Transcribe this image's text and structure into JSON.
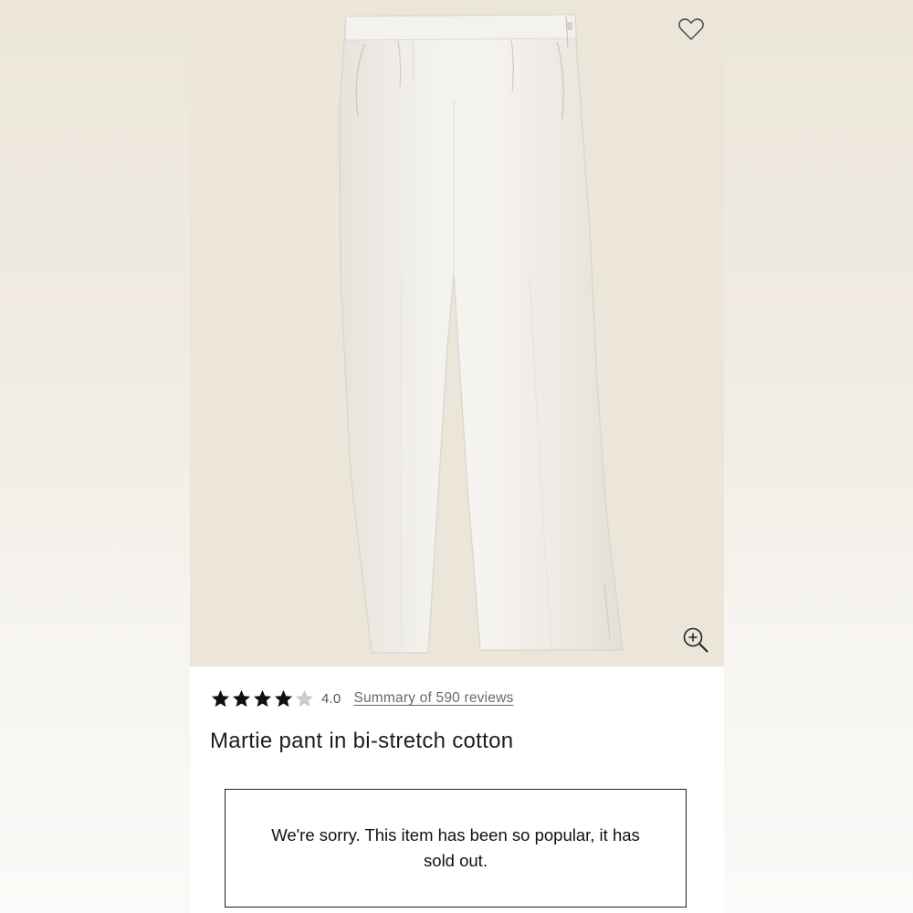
{
  "product": {
    "title": "Martie pant in bi-stretch cotton",
    "rating": {
      "value": 4.0,
      "max": 5,
      "value_label": "4.0",
      "reviews_link": "Summary of 590 reviews"
    },
    "sold_out_message": "We're sorry. This item has been so popular, it has sold out."
  },
  "icons": {
    "wishlist": "heart-outline-icon",
    "zoom": "zoom-in-icon",
    "star_filled": "star-filled-icon",
    "star_empty": "star-empty-icon"
  },
  "colors": {
    "image_background": "#ebe5da",
    "star_filled": "#111111",
    "star_empty": "#cccccc",
    "text": "#1d1d1d",
    "link": "#6a6a6a"
  }
}
